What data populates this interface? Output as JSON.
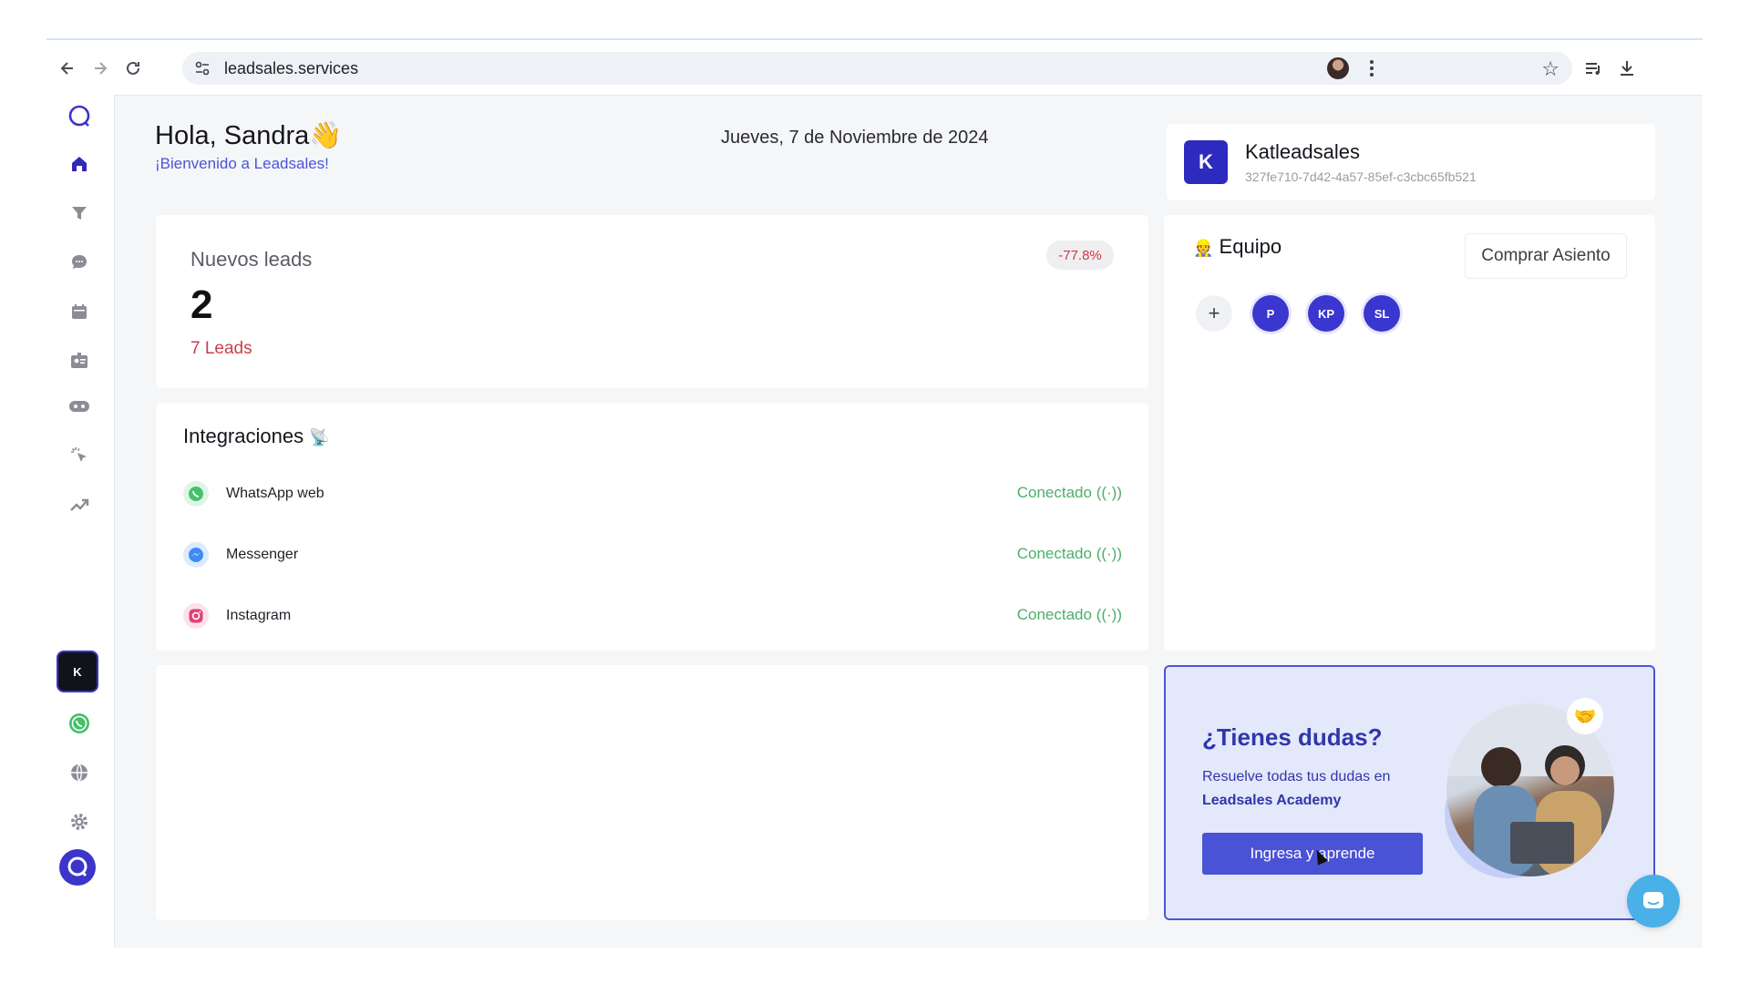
{
  "browser": {
    "url": "leadsales.services"
  },
  "sidebar": {
    "items": [
      {
        "icon": "home-icon"
      },
      {
        "icon": "funnel-icon"
      },
      {
        "icon": "chat-icon"
      },
      {
        "icon": "calendar-icon"
      },
      {
        "icon": "contacts-icon"
      },
      {
        "icon": "bot-icon"
      },
      {
        "icon": "click-icon"
      },
      {
        "icon": "trending-up-icon"
      }
    ],
    "account_initial": "K",
    "bottom_items": [
      {
        "icon": "whatsapp-icon"
      },
      {
        "icon": "globe-icon"
      },
      {
        "icon": "gear-icon"
      }
    ]
  },
  "header": {
    "greeting": "Hola, Sandra",
    "greeting_emoji": "👋",
    "welcome": "¡Bienvenido a Leadsales!",
    "date": "Jueves, 7 de Noviembre de 2024"
  },
  "account": {
    "initial": "K",
    "name": "Katleadsales",
    "id": "327fe710-7d42-4a57-85ef-c3cbc65fb521"
  },
  "leads": {
    "title": "Nuevos leads",
    "count": "2",
    "subtitle": "7 Leads",
    "change": "-77.8%"
  },
  "integrations": {
    "title": "Integraciones",
    "title_emoji": "📡",
    "items": [
      {
        "name": "WhatsApp web",
        "status": "Conectado",
        "color": "#4caf68"
      },
      {
        "name": "Messenger",
        "status": "Conectado",
        "color": "#3d8bf5"
      },
      {
        "name": "Instagram",
        "status": "Conectado",
        "color": "#e0407a"
      }
    ]
  },
  "team": {
    "title": "Equipo",
    "title_emoji": "👷",
    "buy_seat": "Comprar Asiento",
    "add": "+",
    "members": [
      "P",
      "KP",
      "SL"
    ]
  },
  "help": {
    "title": "¿Tienes dudas?",
    "text": "Resuelve todas tus dudas en",
    "text_bold": "Leadsales Academy",
    "button": "Ingresa y aprende",
    "emoji": "🤝"
  },
  "colors": {
    "accent": "#3b35c9",
    "negative": "#c8404a",
    "connected": "#4caf68"
  }
}
